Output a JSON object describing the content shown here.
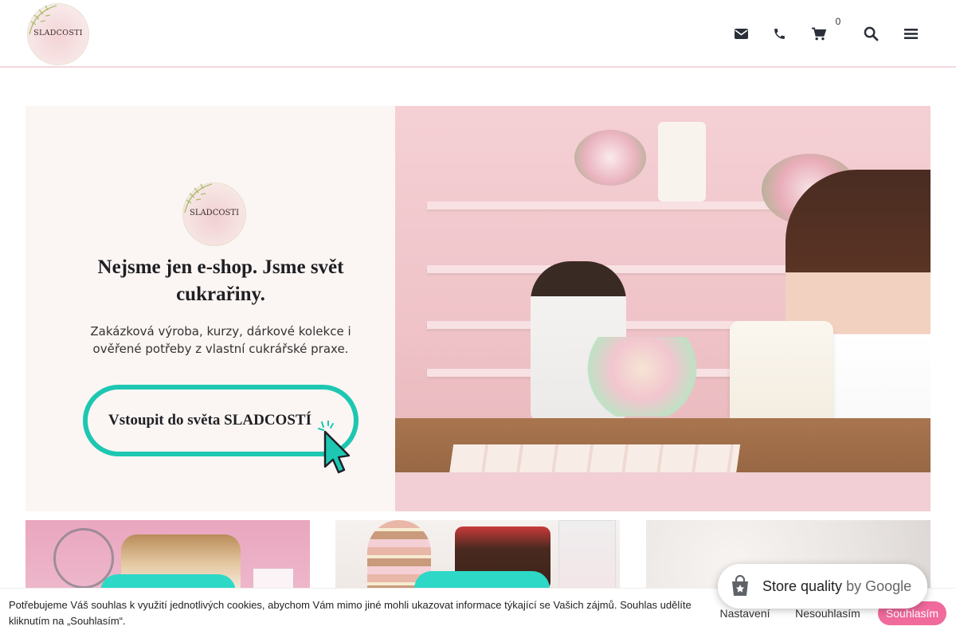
{
  "header": {
    "logo_text": "SLADCOSTI",
    "icons": [
      "mail-icon",
      "phone-icon",
      "cart-icon",
      "search-icon",
      "menu-icon"
    ],
    "cart_count": "0"
  },
  "hero": {
    "logo_text": "SLADCOSTI",
    "title": "Nejsme jen e-shop. Jsme svět cukrařiny.",
    "subtitle": "Zakázková výroba, kurzy, dárkové kolekce i ověřené potřeby z vlastní cukrářské praxe.",
    "cta_label": "Vstoupit do světa SLADCOSTÍ"
  },
  "google_badge": {
    "label": "Store quality",
    "by": "by Google"
  },
  "cookie_bar": {
    "text": "Potřebujeme Váš souhlas k využití jednotlivých cookies, abychom Vám mimo jiné mohli ukazovat informace týkající se Vašich zájmů. Souhlas udělíte kliknutím na „Souhlasím“.",
    "settings_label": "Nastavení",
    "decline_label": "Nesouhlasím",
    "accept_label": "Souhlasím"
  },
  "colors": {
    "accent_teal": "#1dc7b2",
    "accept_pink": "#f06a9c",
    "header_border": "#f3d6dc"
  }
}
